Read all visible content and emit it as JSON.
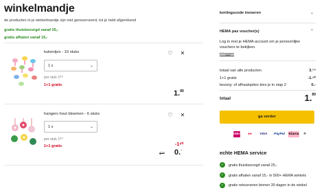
{
  "page": {
    "title": "winkelmandje",
    "subtitle": "de producten in je winkelmandje zijn niet gereserveerd, tot je hebt afgerekend",
    "promos": [
      "gratis thuisbezorgd vanaf 25,-",
      "gratis afhalen vanaf 15,-"
    ]
  },
  "items": [
    {
      "name": "kukentjes - 10 stuks",
      "qty": "1 x",
      "per_stuk": "per stuk 1⁸⁹",
      "promo": "1+1 gratis",
      "price_main": "1.",
      "price_cents": "89"
    },
    {
      "name": "hangers hout bloemen - 6 stuks",
      "qty": "1 x",
      "per_stuk": "per stuk 1⁹⁰",
      "promo": "1+1 gratis",
      "discount": "-1⁹⁰",
      "old_price": "1⁹⁰",
      "price_main": "0.",
      "price_cents": "-"
    }
  ],
  "sidebar": {
    "coupon_label": "kortingscode invoeren",
    "voucher_label": "HEMA pas voucher(s)",
    "voucher_text": "Log in met je HEMA account om je persoonlijke vouchers te bekijken.",
    "login_link": "inloggen",
    "summary": [
      {
        "label": "totaal van alle producten",
        "value": "3.⁷⁹"
      },
      {
        "label": "1+1 gratis",
        "value": "-1.⁹⁰"
      },
      {
        "label": "bezorg- of afhaalopties kies je in stap 2",
        "value": "0.-"
      }
    ],
    "total_label": "totaal",
    "total_main": "1.",
    "total_cents": "89",
    "cta_label": "ga verder",
    "payments": [
      "iDEAL",
      "●●",
      "VISA",
      "PayPal",
      "Klarna",
      ""
    ],
    "service_title": "echte HEMA service",
    "services": [
      "gratis thuisbezorgd vanaf 25,-",
      "gratis afhalen vanaf 15,- in 500+ HEMA winkels",
      "gratis retourneren binnen 30 dagen in de winkel"
    ]
  },
  "colors": {
    "accent_yellow": "#f4c000",
    "promo_green": "#2a8a1f",
    "promo_red": "#d0021b"
  }
}
